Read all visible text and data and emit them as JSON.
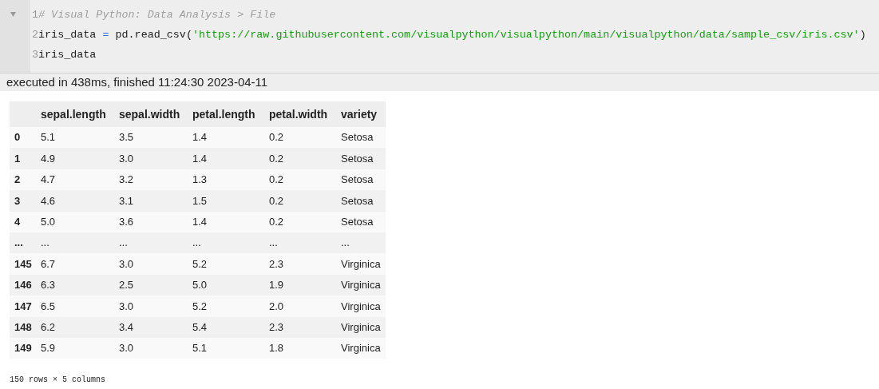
{
  "code_cell": {
    "lines": [
      {
        "number": "1",
        "tokens": [
          {
            "kind": "comment",
            "text": "# Visual Python: Data Analysis > File"
          }
        ]
      },
      {
        "number": "2",
        "tokens": [
          {
            "kind": "plain",
            "text": "iris_data "
          },
          {
            "kind": "operator",
            "text": "="
          },
          {
            "kind": "plain",
            "text": " pd.read_csv("
          },
          {
            "kind": "string",
            "text": "'https://raw.githubusercontent.com/visualpython/visualpython/main/visualpython/data/sample_csv/iris.csv'"
          },
          {
            "kind": "plain",
            "text": ")"
          }
        ]
      },
      {
        "number": "3",
        "tokens": [
          {
            "kind": "plain",
            "text": "iris_data"
          }
        ]
      }
    ]
  },
  "execution_info": "executed in 438ms, finished 11:24:30 2023-04-11",
  "table": {
    "columns": [
      "sepal.length",
      "sepal.width",
      "petal.length",
      "petal.width",
      "variety"
    ],
    "rows": [
      {
        "index": "0",
        "cells": [
          "5.1",
          "3.5",
          "1.4",
          "0.2",
          "Setosa"
        ]
      },
      {
        "index": "1",
        "cells": [
          "4.9",
          "3.0",
          "1.4",
          "0.2",
          "Setosa"
        ]
      },
      {
        "index": "2",
        "cells": [
          "4.7",
          "3.2",
          "1.3",
          "0.2",
          "Setosa"
        ]
      },
      {
        "index": "3",
        "cells": [
          "4.6",
          "3.1",
          "1.5",
          "0.2",
          "Setosa"
        ]
      },
      {
        "index": "4",
        "cells": [
          "5.0",
          "3.6",
          "1.4",
          "0.2",
          "Setosa"
        ]
      },
      {
        "index": "...",
        "cells": [
          "...",
          "...",
          "...",
          "...",
          "..."
        ]
      },
      {
        "index": "145",
        "cells": [
          "6.7",
          "3.0",
          "5.2",
          "2.3",
          "Virginica"
        ]
      },
      {
        "index": "146",
        "cells": [
          "6.3",
          "2.5",
          "5.0",
          "1.9",
          "Virginica"
        ]
      },
      {
        "index": "147",
        "cells": [
          "6.5",
          "3.0",
          "5.2",
          "2.0",
          "Virginica"
        ]
      },
      {
        "index": "148",
        "cells": [
          "6.2",
          "3.4",
          "5.4",
          "2.3",
          "Virginica"
        ]
      },
      {
        "index": "149",
        "cells": [
          "5.9",
          "3.0",
          "5.1",
          "1.8",
          "Virginica"
        ]
      }
    ]
  },
  "shape_note": "150 rows × 5 columns"
}
